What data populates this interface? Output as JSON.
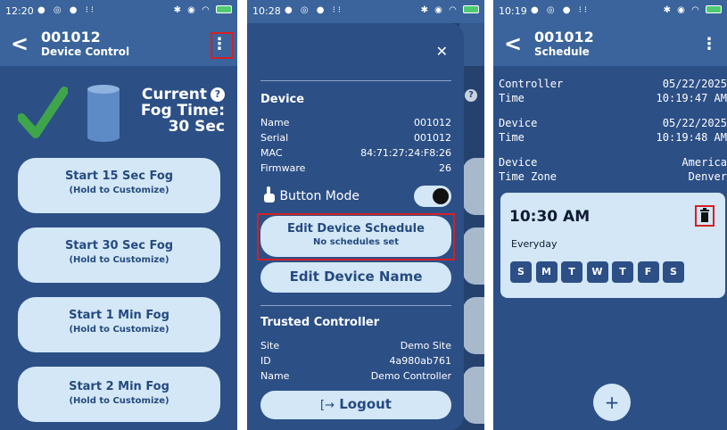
{
  "colors": {
    "background": "#2c4f86",
    "bar": "#3a649b",
    "button": "#d3e7f6",
    "button_text": "#254a80",
    "highlight": "#d42026",
    "check": "#3ea54a"
  },
  "panel1": {
    "status": {
      "time": "12:20"
    },
    "appbar": {
      "title": "001012",
      "subtitle": "Device Control",
      "back_icon": "<",
      "menu_icon": "⋮"
    },
    "current_fog": {
      "line1": "Current",
      "line2": "Fog Time:",
      "line3": "30 Sec",
      "help_icon": "?"
    },
    "fog_buttons": [
      {
        "label": "Start 15 Sec Fog",
        "hint": "(Hold to Customize)"
      },
      {
        "label": "Start 30 Sec Fog",
        "hint": "(Hold to Customize)"
      },
      {
        "label": "Start 1 Min Fog",
        "hint": "(Hold to Customize)"
      },
      {
        "label": "Start 2 Min Fog",
        "hint": "(Hold to Customize)"
      }
    ]
  },
  "panel2": {
    "status": {
      "time": "10:28"
    },
    "close_icon": "✕",
    "background_help_icon": "?",
    "device": {
      "heading": "Device",
      "rows": [
        {
          "k": "Name",
          "v": "001012"
        },
        {
          "k": "Serial",
          "v": "001012"
        },
        {
          "k": "MAC",
          "v": "84:71:27:24:F8:26"
        },
        {
          "k": "Firmware",
          "v": "26"
        }
      ],
      "button_mode_label": "Button Mode",
      "button_mode_on": true
    },
    "edit_schedule": {
      "label": "Edit Device Schedule",
      "sub": "No schedules set"
    },
    "edit_name": {
      "label": "Edit Device Name"
    },
    "trusted": {
      "heading": "Trusted Controller",
      "rows": [
        {
          "k": "Site",
          "v": "Demo Site"
        },
        {
          "k": "ID",
          "v": "4a980ab761"
        },
        {
          "k": "Name",
          "v": "Demo Controller"
        }
      ]
    },
    "logout": {
      "label": "Logout",
      "icon": "[→"
    }
  },
  "panel3": {
    "status": {
      "time": "10:19"
    },
    "appbar": {
      "title": "001012",
      "subtitle": "Schedule",
      "back_icon": "<",
      "menu_icon": "⋮"
    },
    "info": [
      {
        "k1": "Controller",
        "k2": "Time",
        "v1": "05/22/2025",
        "v2": "10:19:47 AM"
      },
      {
        "k1": "Device",
        "k2": "Time",
        "v1": "05/22/2025",
        "v2": "10:19:48 AM"
      },
      {
        "k1": "Device",
        "k2": "Time Zone",
        "v1": "America",
        "v2": "Denver"
      }
    ],
    "schedule": {
      "time": "10:30 AM",
      "repeat": "Everyday",
      "days": [
        "S",
        "M",
        "T",
        "W",
        "T",
        "F",
        "S"
      ]
    },
    "fab_icon": "+"
  }
}
